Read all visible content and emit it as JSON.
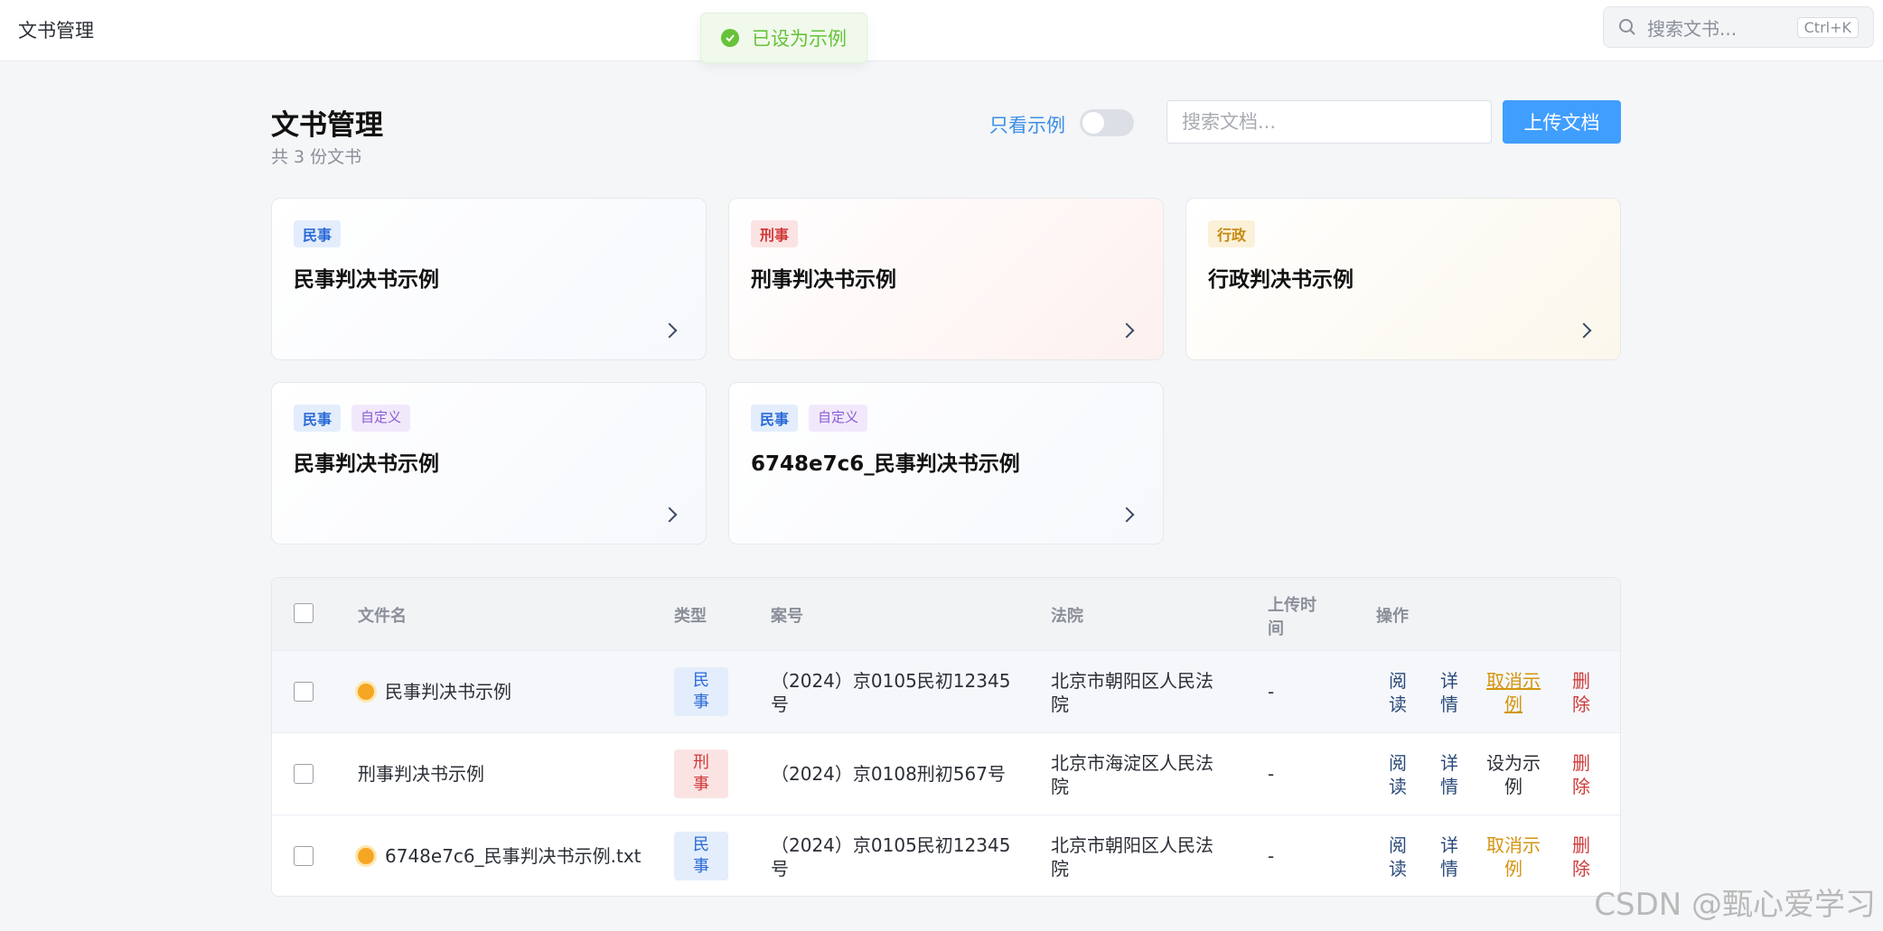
{
  "topbar": {
    "app_title": "文书管理",
    "toast": "已设为示例",
    "search_placeholder": "搜索文书...",
    "shortcut": "Ctrl+K"
  },
  "header": {
    "title": "文书管理",
    "count": "共 3 份文书",
    "toggle_label": "只看示例",
    "toggle_on": false,
    "search_placeholder": "搜索文档...",
    "upload_label": "上传文档"
  },
  "cards": [
    {
      "tag": "民事",
      "custom": "",
      "title": "民事判决书示例"
    },
    {
      "tag": "刑事",
      "custom": "",
      "title": "刑事判决书示例"
    },
    {
      "tag": "行政",
      "custom": "",
      "title": "行政判决书示例"
    },
    {
      "tag": "民事",
      "custom": "自定义",
      "title": "民事判决书示例"
    },
    {
      "tag": "民事",
      "custom": "自定义",
      "title": "6748e7c6_民事判决书示例"
    }
  ],
  "table": {
    "headers": {
      "filename": "文件名",
      "type": "类型",
      "case_no": "案号",
      "court": "法院",
      "upload_time_1": "上传时",
      "upload_time_2": "间",
      "actions": "操作"
    },
    "rows": [
      {
        "filename": "民事判决书示例",
        "type_1": "民",
        "type_2": "事",
        "case_1": "（2024）京0105民初12345",
        "case_2": "号",
        "court_1": "北京市朝阳区人民法",
        "court_2": "院",
        "upload_time": "-",
        "read_1": "阅",
        "read_2": "读",
        "detail_1": "详",
        "detail_2": "情",
        "example_1": "取消示",
        "example_2": "例",
        "delete_1": "删",
        "delete_2": "除"
      },
      {
        "filename": "刑事判决书示例",
        "type_1": "刑",
        "type_2": "事",
        "case_1": "（2024）京0108刑初567号",
        "case_2": "",
        "court_1": "北京市海淀区人民法",
        "court_2": "院",
        "upload_time": "-",
        "read_1": "阅",
        "read_2": "读",
        "detail_1": "详",
        "detail_2": "情",
        "example_1": "设为示",
        "example_2": "例",
        "delete_1": "删",
        "delete_2": "除"
      },
      {
        "filename": "6748e7c6_民事判决书示例.txt",
        "type_1": "民",
        "type_2": "事",
        "case_1": "（2024）京0105民初12345",
        "case_2": "号",
        "court_1": "北京市朝阳区人民法",
        "court_2": "院",
        "upload_time": "-",
        "read_1": "阅",
        "read_2": "读",
        "detail_1": "详",
        "detail_2": "情",
        "example_1": "取消示",
        "example_2": "例",
        "delete_1": "删",
        "delete_2": "除"
      }
    ]
  },
  "watermark": "CSDN @甄心爱学习"
}
